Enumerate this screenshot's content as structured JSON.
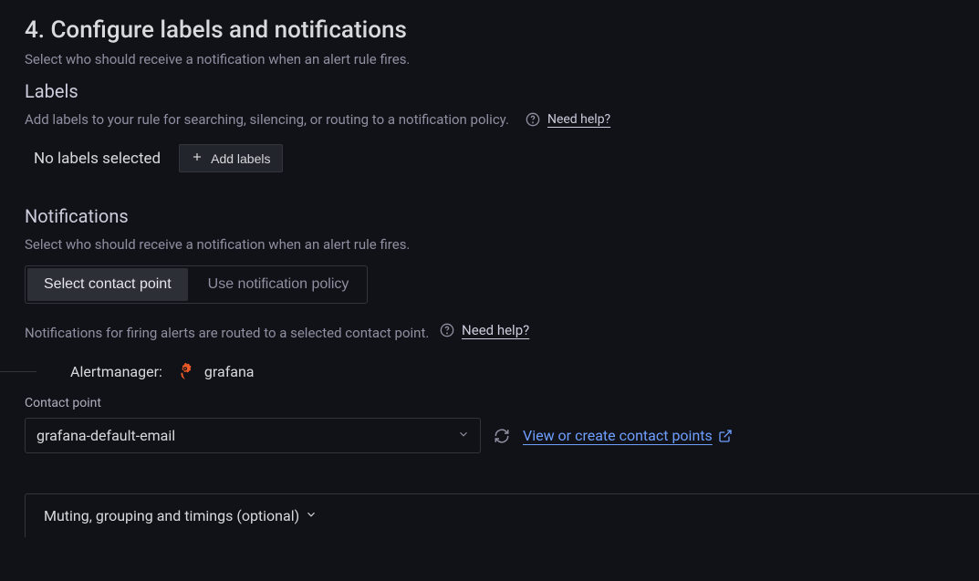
{
  "header": {
    "title": "4. Configure labels and notifications",
    "subtitle": "Select who should receive a notification when an alert rule fires."
  },
  "labels": {
    "title": "Labels",
    "description": "Add labels to your rule for searching, silencing, or routing to a notification policy.",
    "help_text": "Need help?",
    "status": "No labels selected",
    "add_button": "Add labels"
  },
  "notifications": {
    "title": "Notifications",
    "subtitle": "Select who should receive a notification when an alert rule fires.",
    "toggle": {
      "contact_point": "Select contact point",
      "policy": "Use notification policy"
    },
    "routed_desc": "Notifications for firing alerts are routed to a selected contact point.",
    "help_text": "Need help?",
    "alertmanager_label": "Alertmanager:",
    "alertmanager_name": "grafana",
    "contact_point_label": "Contact point",
    "contact_point_value": "grafana-default-email",
    "view_link": "View or create contact points"
  },
  "collapsible": {
    "title": "Muting, grouping and timings (optional)"
  }
}
